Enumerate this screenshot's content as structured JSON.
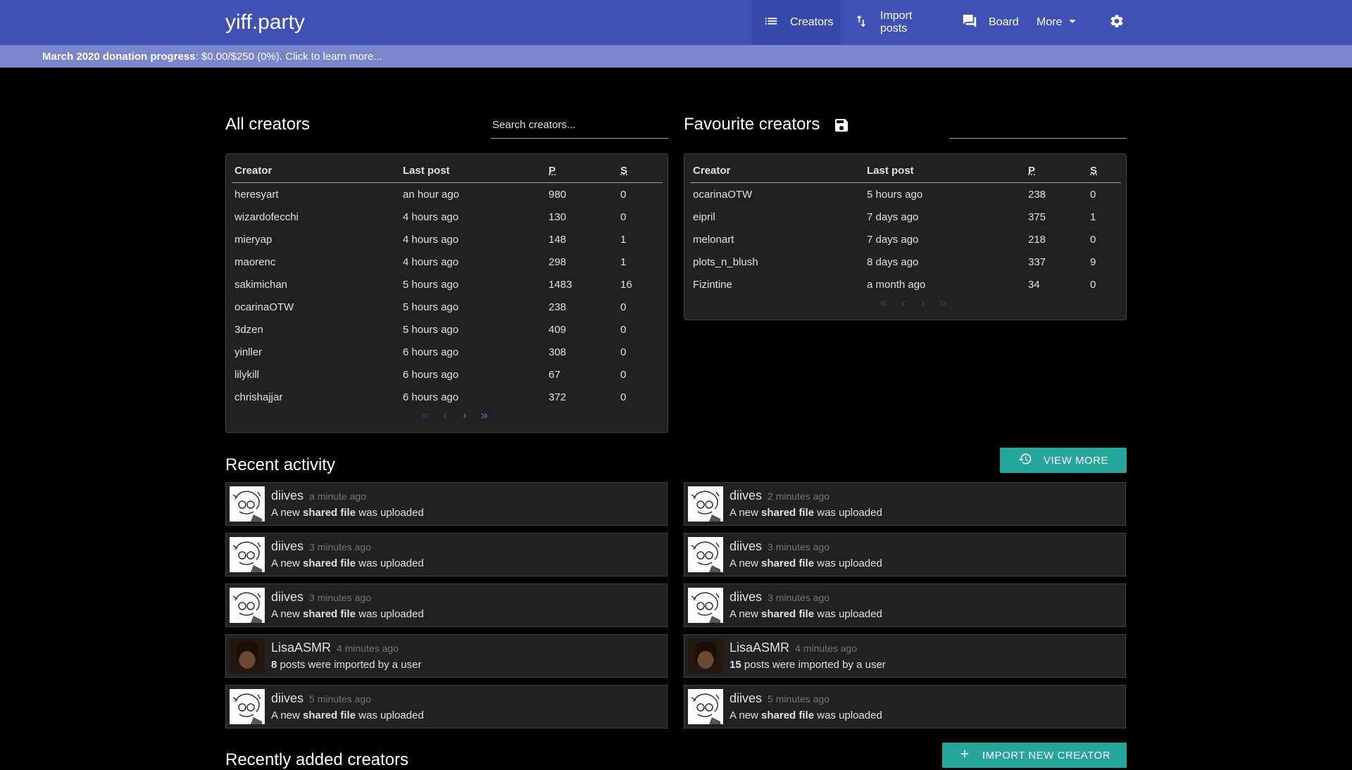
{
  "nav": {
    "brand": "yiff.party",
    "items": [
      {
        "label": "Creators",
        "icon": "list-icon"
      },
      {
        "label": "Import posts",
        "icon": "swap-vertical-icon"
      },
      {
        "label": "Board",
        "icon": "forum-icon"
      },
      {
        "label": "More",
        "icon": "arrow-drop-down-icon"
      }
    ],
    "settings_icon": "settings-gear-icon"
  },
  "banner": {
    "lead": "March 2020 donation progress",
    "rest": ": $0.00/$250 (0%). Click to learn more..."
  },
  "all_creators": {
    "title": "All creators",
    "search_placeholder": "Search creators...",
    "headers": [
      "Creator",
      "Last post",
      "P",
      "S"
    ],
    "rows": [
      [
        "heresyart",
        "an hour ago",
        "980",
        "0"
      ],
      [
        "wizardofecchi",
        "4 hours ago",
        "130",
        "0"
      ],
      [
        "mieryap",
        "4 hours ago",
        "148",
        "1"
      ],
      [
        "maorenc",
        "4 hours ago",
        "298",
        "1"
      ],
      [
        "sakimichan",
        "5 hours ago",
        "1483",
        "16"
      ],
      [
        "ocarinaOTW",
        "5 hours ago",
        "238",
        "0"
      ],
      [
        "3dzen",
        "5 hours ago",
        "409",
        "0"
      ],
      [
        "yinller",
        "6 hours ago",
        "308",
        "0"
      ],
      [
        "lilykill",
        "6 hours ago",
        "67",
        "0"
      ],
      [
        "chrishajjar",
        "6 hours ago",
        "372",
        "0"
      ]
    ],
    "pager": [
      "«",
      "‹",
      "›",
      "»"
    ]
  },
  "favourite_creators": {
    "title": "Favourite creators",
    "save_icon": "floppy-save-icon",
    "headers": [
      "Creator",
      "Last post",
      "P",
      "S"
    ],
    "rows": [
      [
        "ocarinaOTW",
        "5 hours ago",
        "238",
        "0"
      ],
      [
        "eipril",
        "7 days ago",
        "375",
        "1"
      ],
      [
        "melonart",
        "7 days ago",
        "218",
        "0"
      ],
      [
        "plots_n_blush",
        "8 days ago",
        "337",
        "9"
      ],
      [
        "Fizintine",
        "a month ago",
        "34",
        "0"
      ]
    ],
    "pager": [
      "«",
      "‹",
      "›",
      "»"
    ]
  },
  "recent_activity": {
    "title": "Recent activity",
    "view_more": "VIEW MORE",
    "left": [
      {
        "name": "diives",
        "time": "a minute ago",
        "pre": "A new ",
        "bold": "shared file",
        "post": " was uploaded"
      },
      {
        "name": "diives",
        "time": "3 minutes ago",
        "pre": "A new ",
        "bold": "shared file",
        "post": " was uploaded"
      },
      {
        "name": "diives",
        "time": "3 minutes ago",
        "pre": "A new ",
        "bold": "shared file",
        "post": " was uploaded"
      },
      {
        "name": "LisaASMR",
        "time": "4 minutes ago",
        "pre": "",
        "bold": "8",
        "post": " posts were imported by a user"
      },
      {
        "name": "diives",
        "time": "5 minutes ago",
        "pre": "A new ",
        "bold": "shared file",
        "post": " was uploaded"
      }
    ],
    "right": [
      {
        "name": "diives",
        "time": "2 minutes ago",
        "pre": "A new ",
        "bold": "shared file",
        "post": " was uploaded"
      },
      {
        "name": "diives",
        "time": "3 minutes ago",
        "pre": "A new ",
        "bold": "shared file",
        "post": " was uploaded"
      },
      {
        "name": "diives",
        "time": "3 minutes ago",
        "pre": "A new ",
        "bold": "shared file",
        "post": " was uploaded"
      },
      {
        "name": "LisaASMR",
        "time": "4 minutes ago",
        "pre": "",
        "bold": "15",
        "post": " posts were imported by a user"
      },
      {
        "name": "diives",
        "time": "5 minutes ago",
        "pre": "A new ",
        "bold": "shared file",
        "post": " was uploaded"
      }
    ]
  },
  "recently_added": {
    "title": "Recently added creators",
    "import_button": "IMPORT NEW CREATOR"
  },
  "colors": {
    "nav_bg": "#3f51b5",
    "banner_bg": "#7986cb",
    "card_bg": "#212121",
    "accent_button": "#26a69a"
  }
}
